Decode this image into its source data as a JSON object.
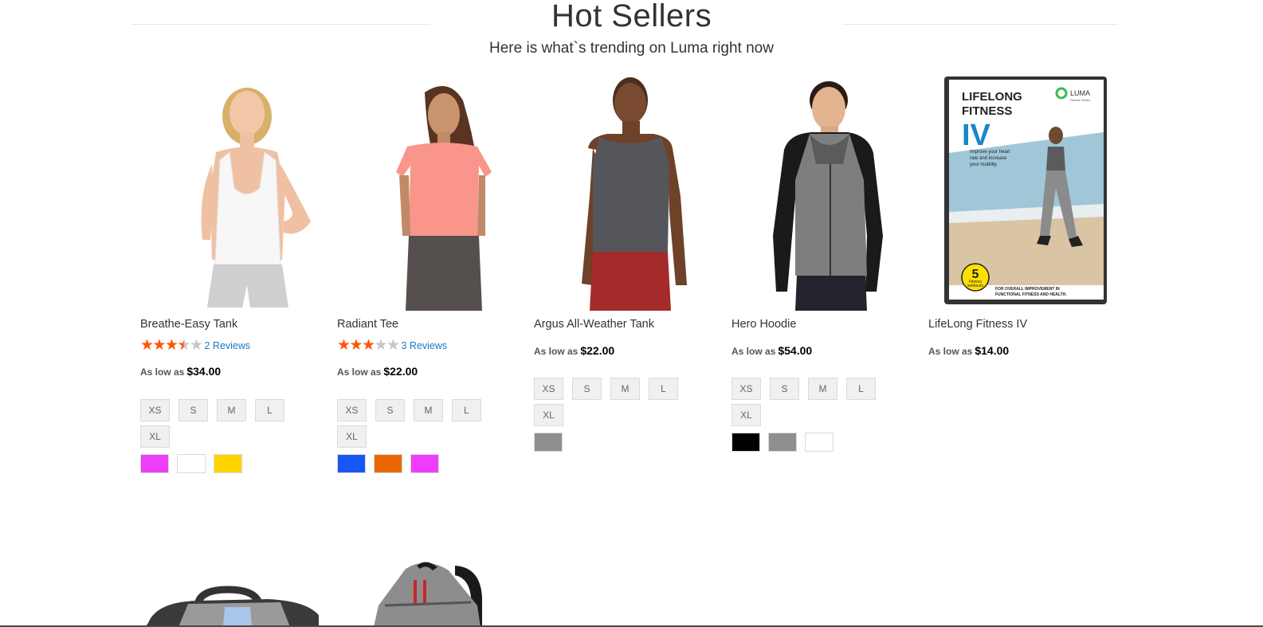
{
  "section": {
    "title": "Hot Sellers",
    "subtitle": "Here is what`s trending on Luma right now"
  },
  "products": [
    {
      "name": "Breathe-Easy Tank",
      "rating_stars": 3.5,
      "reviews": "2 Reviews",
      "price_prefix": "As low as",
      "price": "$34.00",
      "sizes": [
        "XS",
        "S",
        "M",
        "L",
        "XL"
      ],
      "colors": [
        "#ee3ef7",
        "#ffffff",
        "#ffd500"
      ]
    },
    {
      "name": "Radiant Tee",
      "rating_stars": 3,
      "reviews": "3 Reviews",
      "price_prefix": "As low as",
      "price": "$22.00",
      "sizes": [
        "XS",
        "S",
        "M",
        "L",
        "XL"
      ],
      "colors": [
        "#1857f7",
        "#eb6703",
        "#ef3dff"
      ]
    },
    {
      "name": "Argus All-Weather Tank",
      "price_prefix": "As low as",
      "price": "$22.00",
      "sizes": [
        "XS",
        "S",
        "M",
        "L",
        "XL"
      ],
      "colors": [
        "#8f8f8f"
      ]
    },
    {
      "name": "Hero Hoodie",
      "price_prefix": "As low as",
      "price": "$54.00",
      "sizes": [
        "XS",
        "S",
        "M",
        "L",
        "XL"
      ],
      "colors": [
        "#000000",
        "#8f8f8f",
        "#ffffff"
      ]
    },
    {
      "name": "LifeLong Fitness IV",
      "price_prefix": "As low as",
      "price": "$14.00",
      "dvd_cover": {
        "title_line1": "LIFELONG",
        "title_line2": "FITNESS",
        "title_line3": "IV",
        "brand": "LUMA",
        "brand_sub": "Fitness Studio",
        "tagline_1": "Improve your heart",
        "tagline_2": "rate and increase",
        "tagline_3": "your mobility.",
        "badge_number": "5",
        "badge_line1": "Fitness",
        "badge_line2": "workouts",
        "footer_1": "FOR OVERALL IMPROVEMENT IN",
        "footer_2": "FUNCTIONAL FITNESS AND HEALTH."
      }
    }
  ]
}
